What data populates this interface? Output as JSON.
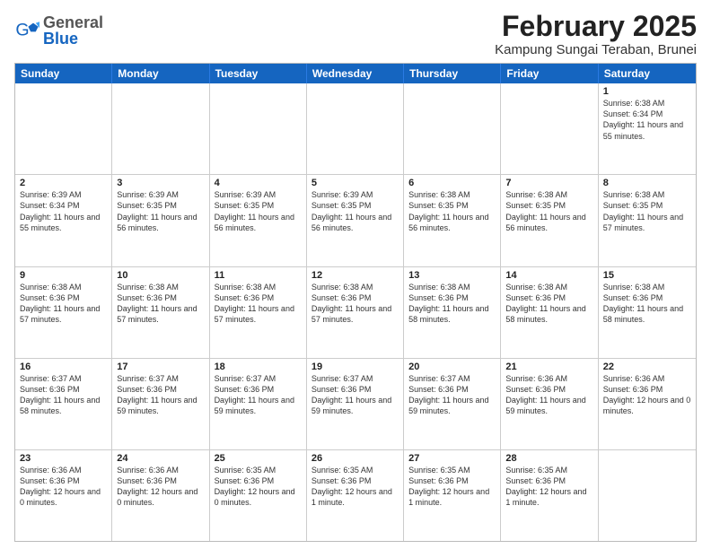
{
  "header": {
    "logo": {
      "general": "General",
      "blue": "Blue"
    },
    "title": "February 2025",
    "location": "Kampung Sungai Teraban, Brunei"
  },
  "weekdays": [
    "Sunday",
    "Monday",
    "Tuesday",
    "Wednesday",
    "Thursday",
    "Friday",
    "Saturday"
  ],
  "weeks": [
    [
      {
        "day": "",
        "empty": true
      },
      {
        "day": "",
        "empty": true
      },
      {
        "day": "",
        "empty": true
      },
      {
        "day": "",
        "empty": true
      },
      {
        "day": "",
        "empty": true
      },
      {
        "day": "",
        "empty": true
      },
      {
        "day": "1",
        "sunrise": "Sunrise: 6:38 AM",
        "sunset": "Sunset: 6:34 PM",
        "daylight": "Daylight: 11 hours and 55 minutes."
      }
    ],
    [
      {
        "day": "2",
        "sunrise": "Sunrise: 6:39 AM",
        "sunset": "Sunset: 6:34 PM",
        "daylight": "Daylight: 11 hours and 55 minutes."
      },
      {
        "day": "3",
        "sunrise": "Sunrise: 6:39 AM",
        "sunset": "Sunset: 6:35 PM",
        "daylight": "Daylight: 11 hours and 56 minutes."
      },
      {
        "day": "4",
        "sunrise": "Sunrise: 6:39 AM",
        "sunset": "Sunset: 6:35 PM",
        "daylight": "Daylight: 11 hours and 56 minutes."
      },
      {
        "day": "5",
        "sunrise": "Sunrise: 6:39 AM",
        "sunset": "Sunset: 6:35 PM",
        "daylight": "Daylight: 11 hours and 56 minutes."
      },
      {
        "day": "6",
        "sunrise": "Sunrise: 6:38 AM",
        "sunset": "Sunset: 6:35 PM",
        "daylight": "Daylight: 11 hours and 56 minutes."
      },
      {
        "day": "7",
        "sunrise": "Sunrise: 6:38 AM",
        "sunset": "Sunset: 6:35 PM",
        "daylight": "Daylight: 11 hours and 56 minutes."
      },
      {
        "day": "8",
        "sunrise": "Sunrise: 6:38 AM",
        "sunset": "Sunset: 6:35 PM",
        "daylight": "Daylight: 11 hours and 57 minutes."
      }
    ],
    [
      {
        "day": "9",
        "sunrise": "Sunrise: 6:38 AM",
        "sunset": "Sunset: 6:36 PM",
        "daylight": "Daylight: 11 hours and 57 minutes."
      },
      {
        "day": "10",
        "sunrise": "Sunrise: 6:38 AM",
        "sunset": "Sunset: 6:36 PM",
        "daylight": "Daylight: 11 hours and 57 minutes."
      },
      {
        "day": "11",
        "sunrise": "Sunrise: 6:38 AM",
        "sunset": "Sunset: 6:36 PM",
        "daylight": "Daylight: 11 hours and 57 minutes."
      },
      {
        "day": "12",
        "sunrise": "Sunrise: 6:38 AM",
        "sunset": "Sunset: 6:36 PM",
        "daylight": "Daylight: 11 hours and 57 minutes."
      },
      {
        "day": "13",
        "sunrise": "Sunrise: 6:38 AM",
        "sunset": "Sunset: 6:36 PM",
        "daylight": "Daylight: 11 hours and 58 minutes."
      },
      {
        "day": "14",
        "sunrise": "Sunrise: 6:38 AM",
        "sunset": "Sunset: 6:36 PM",
        "daylight": "Daylight: 11 hours and 58 minutes."
      },
      {
        "day": "15",
        "sunrise": "Sunrise: 6:38 AM",
        "sunset": "Sunset: 6:36 PM",
        "daylight": "Daylight: 11 hours and 58 minutes."
      }
    ],
    [
      {
        "day": "16",
        "sunrise": "Sunrise: 6:37 AM",
        "sunset": "Sunset: 6:36 PM",
        "daylight": "Daylight: 11 hours and 58 minutes."
      },
      {
        "day": "17",
        "sunrise": "Sunrise: 6:37 AM",
        "sunset": "Sunset: 6:36 PM",
        "daylight": "Daylight: 11 hours and 59 minutes."
      },
      {
        "day": "18",
        "sunrise": "Sunrise: 6:37 AM",
        "sunset": "Sunset: 6:36 PM",
        "daylight": "Daylight: 11 hours and 59 minutes."
      },
      {
        "day": "19",
        "sunrise": "Sunrise: 6:37 AM",
        "sunset": "Sunset: 6:36 PM",
        "daylight": "Daylight: 11 hours and 59 minutes."
      },
      {
        "day": "20",
        "sunrise": "Sunrise: 6:37 AM",
        "sunset": "Sunset: 6:36 PM",
        "daylight": "Daylight: 11 hours and 59 minutes."
      },
      {
        "day": "21",
        "sunrise": "Sunrise: 6:36 AM",
        "sunset": "Sunset: 6:36 PM",
        "daylight": "Daylight: 11 hours and 59 minutes."
      },
      {
        "day": "22",
        "sunrise": "Sunrise: 6:36 AM",
        "sunset": "Sunset: 6:36 PM",
        "daylight": "Daylight: 12 hours and 0 minutes."
      }
    ],
    [
      {
        "day": "23",
        "sunrise": "Sunrise: 6:36 AM",
        "sunset": "Sunset: 6:36 PM",
        "daylight": "Daylight: 12 hours and 0 minutes."
      },
      {
        "day": "24",
        "sunrise": "Sunrise: 6:36 AM",
        "sunset": "Sunset: 6:36 PM",
        "daylight": "Daylight: 12 hours and 0 minutes."
      },
      {
        "day": "25",
        "sunrise": "Sunrise: 6:35 AM",
        "sunset": "Sunset: 6:36 PM",
        "daylight": "Daylight: 12 hours and 0 minutes."
      },
      {
        "day": "26",
        "sunrise": "Sunrise: 6:35 AM",
        "sunset": "Sunset: 6:36 PM",
        "daylight": "Daylight: 12 hours and 1 minute."
      },
      {
        "day": "27",
        "sunrise": "Sunrise: 6:35 AM",
        "sunset": "Sunset: 6:36 PM",
        "daylight": "Daylight: 12 hours and 1 minute."
      },
      {
        "day": "28",
        "sunrise": "Sunrise: 6:35 AM",
        "sunset": "Sunset: 6:36 PM",
        "daylight": "Daylight: 12 hours and 1 minute."
      },
      {
        "day": "",
        "empty": true
      }
    ]
  ]
}
